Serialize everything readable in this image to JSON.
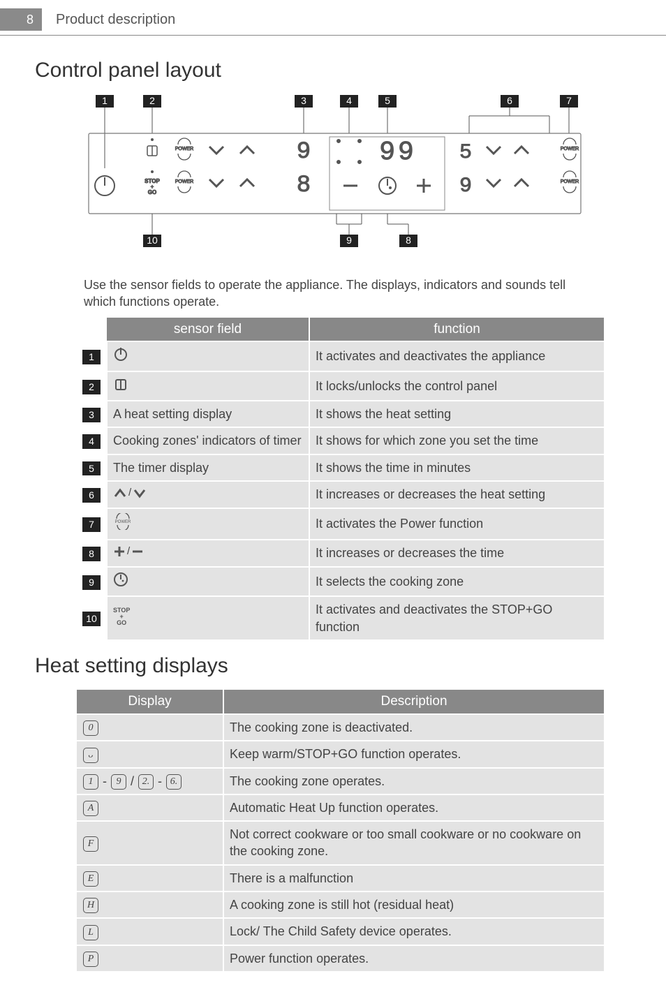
{
  "page_number": "8",
  "breadcrumb": "Product description",
  "sections": {
    "control_panel": "Control panel layout",
    "heat_displays": "Heat setting displays"
  },
  "intro_text": "Use the sensor fields to operate the appliance. The displays, indicators and sounds tell which functions operate.",
  "control_table": {
    "headers": {
      "sensor": "sensor field",
      "function": "function"
    },
    "rows": [
      {
        "idx": "1",
        "sensor_text": "",
        "sensor_icon": "power",
        "func": "It activates and deactivates the appliance"
      },
      {
        "idx": "2",
        "sensor_text": "",
        "sensor_icon": "lock",
        "func": "It locks/unlocks the control panel"
      },
      {
        "idx": "3",
        "sensor_text": "A heat setting display",
        "sensor_icon": "",
        "func": "It shows the heat setting"
      },
      {
        "idx": "4",
        "sensor_text": "Cooking zones' indicators of timer",
        "sensor_icon": "",
        "func": "It shows for which zone you set the time"
      },
      {
        "idx": "5",
        "sensor_text": "The timer display",
        "sensor_icon": "",
        "func": "It shows the time in minutes"
      },
      {
        "idx": "6",
        "sensor_text": "",
        "sensor_icon": "updown",
        "func": "It increases or decreases the heat setting"
      },
      {
        "idx": "7",
        "sensor_text": "",
        "sensor_icon": "powerfn",
        "func": "It activates the Power function"
      },
      {
        "idx": "8",
        "sensor_text": "",
        "sensor_icon": "plusminus",
        "func": "It increases or decreases the time"
      },
      {
        "idx": "9",
        "sensor_text": "",
        "sensor_icon": "clock",
        "func": "It selects the cooking zone"
      },
      {
        "idx": "10",
        "sensor_text": "",
        "sensor_icon": "stopgo",
        "func": "It activates and deactivates the STOP+GO function"
      }
    ]
  },
  "display_table": {
    "headers": {
      "display": "Display",
      "description": "Description"
    },
    "rows": [
      {
        "icon": "d0",
        "desc": "The cooking zone is deactivated."
      },
      {
        "icon": "du",
        "desc": "Keep warm/STOP+GO function operates."
      },
      {
        "icon": "drange",
        "desc": "The cooking zone operates."
      },
      {
        "icon": "dA",
        "desc": "Automatic Heat Up function operates."
      },
      {
        "icon": "dF",
        "desc": "Not correct cookware or too small cookware or no cookware on the cooking zone."
      },
      {
        "icon": "dE",
        "desc": "There is a malfunction"
      },
      {
        "icon": "dH",
        "desc": "A cooking zone is still hot (residual heat)"
      },
      {
        "icon": "dL",
        "desc": "Lock/ The Child Safety device operates."
      },
      {
        "icon": "dP",
        "desc": "Power function operates."
      }
    ]
  },
  "icon_labels": {
    "power_word": "POWER",
    "stopgo_word_top": "STOP",
    "stopgo_word_plus": "+",
    "stopgo_word_bot": "GO",
    "range_sep": " - ",
    "range_slash": " / ",
    "digit_0": "0",
    "digit_u": "ᴗ",
    "digit_1": "1",
    "digit_9": "9",
    "digit_2": "2.",
    "digit_6": "6.",
    "digit_A": "A",
    "digit_F": "F",
    "digit_E": "E",
    "digit_H": "H",
    "digit_L": "L",
    "digit_P": "P"
  },
  "diagram": {
    "callouts_top": [
      "1",
      "2",
      "3",
      "4",
      "5",
      "6",
      "7"
    ],
    "callouts_bottom": [
      "10",
      "9",
      "8"
    ],
    "panel_digits": {
      "leftTop": "9",
      "leftBot": "8",
      "center": "99",
      "rightTop": "5",
      "rightBot": "9"
    }
  }
}
